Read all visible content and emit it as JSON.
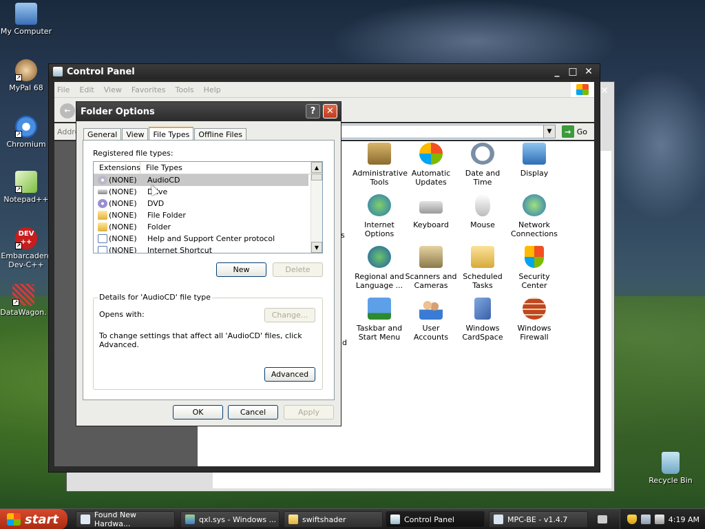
{
  "desktop": {
    "icons": [
      {
        "label": "My Computer"
      },
      {
        "label": "MyPal 68"
      },
      {
        "label": "Chromium"
      },
      {
        "label": "Notepad++"
      },
      {
        "label": "Embarcadero Dev-C++"
      },
      {
        "label": "DataWagon."
      },
      {
        "label": "Recycle Bin"
      }
    ],
    "dev_badge": "DEV\n++"
  },
  "control_panel": {
    "title": "Control Panel",
    "menu": [
      "File",
      "Edit",
      "View",
      "Favorites",
      "Tools",
      "Help"
    ],
    "go_label": "Go",
    "items": [
      {
        "label": "Administrative Tools"
      },
      {
        "label": "Automatic Updates"
      },
      {
        "label": "Date and Time"
      },
      {
        "label": "Display"
      },
      {
        "label": "Internet Options"
      },
      {
        "label": "Keyboard"
      },
      {
        "label": "Mouse"
      },
      {
        "label": "Network Connections"
      },
      {
        "label": "Regional and Language ..."
      },
      {
        "label": "Scanners and Cameras"
      },
      {
        "label": "Scheduled Tasks"
      },
      {
        "label": "Security Center"
      },
      {
        "label": "Taskbar and Start Menu"
      },
      {
        "label": "User Accounts"
      },
      {
        "label": "Windows CardSpace"
      },
      {
        "label": "Windows Firewall"
      }
    ],
    "partial_text": {
      "addr": "Addre",
      "s": "s",
      "nd": "nd"
    }
  },
  "folder_options": {
    "title": "Folder Options",
    "help": "?",
    "close": "✕",
    "tabs": [
      "General",
      "View",
      "File Types",
      "Offline Files"
    ],
    "active_tab": "File Types",
    "registered_label": "Registered file types:",
    "columns": [
      "Extensions",
      "File Types"
    ],
    "rows": [
      {
        "ext": "(NONE)",
        "type": "AudioCD",
        "selected": true
      },
      {
        "ext": "(NONE)",
        "type": "Drive"
      },
      {
        "ext": "(NONE)",
        "type": "DVD"
      },
      {
        "ext": "(NONE)",
        "type": "File Folder"
      },
      {
        "ext": "(NONE)",
        "type": "Folder"
      },
      {
        "ext": "(NONE)",
        "type": "Help and Support Center protocol"
      },
      {
        "ext": "(NONE)",
        "type": "Internet Shortcut"
      }
    ],
    "new_label": "New",
    "delete_label": "Delete",
    "details_title": "Details for 'AudioCD' file type",
    "opens_with": "Opens with:",
    "change_label": "Change...",
    "note": "To change settings that affect all 'AudioCD' files, click Advanced.",
    "advanced_label": "Advanced",
    "ok_label": "OK",
    "cancel_label": "Cancel",
    "apply_label": "Apply"
  },
  "taskbar": {
    "start_label": "start",
    "tasks": [
      {
        "label": "Found New Hardwa..."
      },
      {
        "label": "qxl.sys - Windows ..."
      },
      {
        "label": "swiftshader"
      },
      {
        "label": "Control Panel"
      },
      {
        "label": "MPC-BE - v1.4.7"
      }
    ],
    "clock": "4:19 AM"
  }
}
